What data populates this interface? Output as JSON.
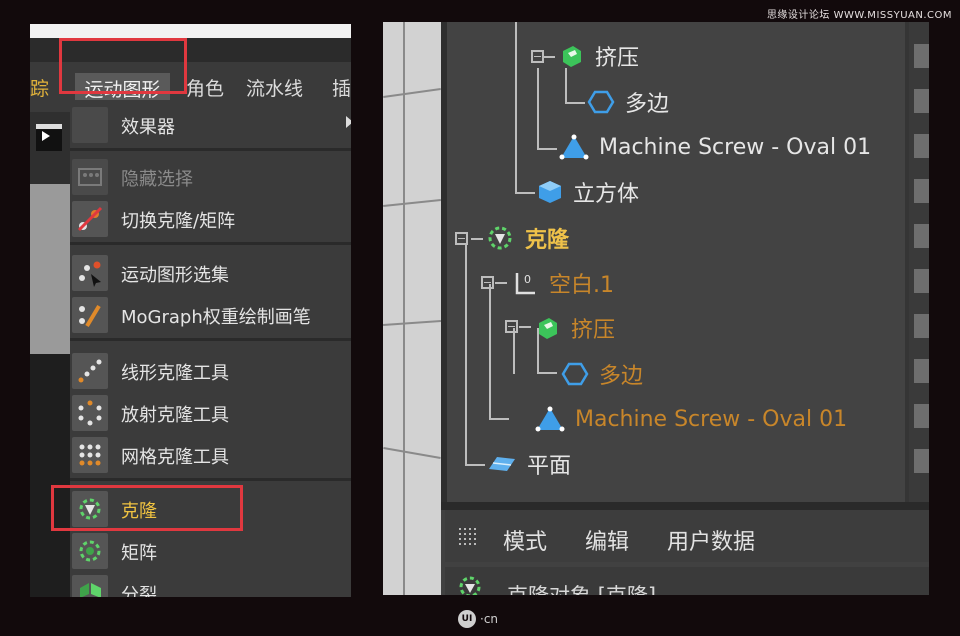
{
  "watermark": "思缘设计论坛 WWW.MISSYUAN.COM",
  "footer_logo": {
    "badge": "UI",
    "suffix": "·cn"
  },
  "left_panel": {
    "menubar": {
      "items": [
        "踪",
        "运动图形",
        "角色",
        "流水线",
        "插"
      ],
      "active": "运动图形"
    },
    "dropdown": [
      {
        "label": "效果器",
        "icon": "effector-icon",
        "submenu": true
      },
      {
        "label": "隐藏选择",
        "icon": "hide-selection-icon",
        "disabled": true
      },
      {
        "label": "切换克隆/矩阵",
        "icon": "toggle-clone-matrix-icon"
      },
      {
        "label": "运动图形选集",
        "icon": "mograph-selection-icon"
      },
      {
        "label": "MoGraph权重绘制画笔",
        "icon": "mograph-weight-brush-icon"
      },
      {
        "label": "线形克隆工具",
        "icon": "linear-clone-icon"
      },
      {
        "label": "放射克隆工具",
        "icon": "radial-clone-icon"
      },
      {
        "label": "网格克隆工具",
        "icon": "grid-clone-icon"
      },
      {
        "label": "克隆",
        "icon": "cloner-icon",
        "highlighted": true
      },
      {
        "label": "矩阵",
        "icon": "matrix-icon"
      },
      {
        "label": "分裂",
        "icon": "fracture-icon"
      }
    ]
  },
  "right_panel": {
    "tree": [
      {
        "label": "挤压",
        "icon": "extrude-icon",
        "color": "white"
      },
      {
        "label": "多边",
        "icon": "polygon-icon",
        "color": "white"
      },
      {
        "label": "Machine Screw - Oval 01",
        "icon": "machine-screw-icon",
        "color": "white"
      },
      {
        "label": "立方体",
        "icon": "cube-icon",
        "color": "white"
      },
      {
        "label": "克隆",
        "icon": "cloner-icon",
        "color": "yellow"
      },
      {
        "label": "空白.1",
        "icon": "null-object-icon",
        "color": "gold"
      },
      {
        "label": "挤压",
        "icon": "extrude-icon",
        "color": "gold"
      },
      {
        "label": "多边",
        "icon": "polygon-icon",
        "color": "gold"
      },
      {
        "label": "Machine Screw - Oval 01",
        "icon": "machine-screw-icon",
        "color": "gold"
      },
      {
        "label": "平面",
        "icon": "plane-icon",
        "color": "white"
      }
    ],
    "tabs": [
      "模式",
      "编辑",
      "用户数据"
    ],
    "attribute_title": "克隆对象 [克隆]"
  },
  "colors": {
    "highlight_box": "#e0383f",
    "active_label": "#efc24a",
    "child_label": "#c8862a"
  }
}
